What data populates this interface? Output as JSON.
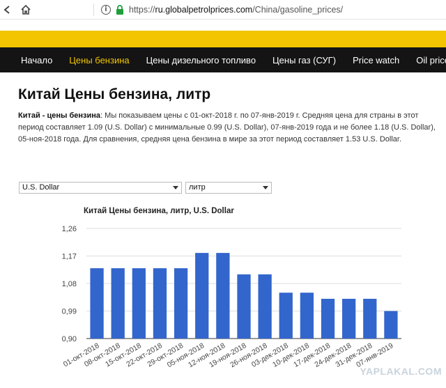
{
  "browser": {
    "url_prefix": "https://",
    "url_host": "ru.globalpetrolprices.com",
    "url_path": "/China/gasoline_prices/"
  },
  "nav": {
    "items": [
      {
        "label": "Начало",
        "active": false
      },
      {
        "label": "Цены бензина",
        "active": true
      },
      {
        "label": "Цены дизельного топливо",
        "active": false
      },
      {
        "label": "Цены газ (СУГ)",
        "active": false
      },
      {
        "label": "Price watch",
        "active": false
      },
      {
        "label": "Oil prices",
        "active": false
      }
    ]
  },
  "page": {
    "title": "Китай Цены бензина, литр",
    "desc_bold": "Китай - цены бензина",
    "desc_text": ": Мы показываем цены с 01-окт-2018 г. по 07-янв-2019 г. Средняя цена для страны в этот период составляет 1.09 (U.S. Dollar) с минимальные 0.99 (U.S. Dollar), 07-янв-2019 года и не более 1.18 (U.S. Dollar), 05-ноя-2018 года. Для сравнения, средняя цена бензина в мире за этот период составляет 1.53 U.S. Dollar."
  },
  "selectors": {
    "currency": "U.S. Dollar",
    "unit": "литр"
  },
  "watermark": "YAPLAKAL.COM",
  "colors": {
    "bar": "#3366cc",
    "nav_bg": "#141414",
    "accent": "#f2c500"
  },
  "chart_data": {
    "type": "bar",
    "title": "Китай Цены бензина, литр, U.S. Dollar",
    "categories": [
      "01-окт-2018",
      "08-окт-2018",
      "15-окт-2018",
      "22-окт-2018",
      "29-окт-2018",
      "05-ноя-2018",
      "12-ноя-2018",
      "19-ноя-2018",
      "26-ноя-2018",
      "03-дек-2018",
      "10-дек-2018",
      "17-дек-2018",
      "24-дек-2018",
      "31-дек-2018",
      "07-янв-2019"
    ],
    "values": [
      1.13,
      1.13,
      1.13,
      1.13,
      1.13,
      1.18,
      1.18,
      1.11,
      1.11,
      1.05,
      1.05,
      1.03,
      1.03,
      1.03,
      0.99
    ],
    "yticks": [
      "1,26",
      "1,17",
      "1,08",
      "0,99",
      "0,90"
    ],
    "ytick_values": [
      1.26,
      1.17,
      1.08,
      0.99,
      0.9
    ],
    "ylim": [
      0.9,
      1.26
    ],
    "grid": true
  }
}
